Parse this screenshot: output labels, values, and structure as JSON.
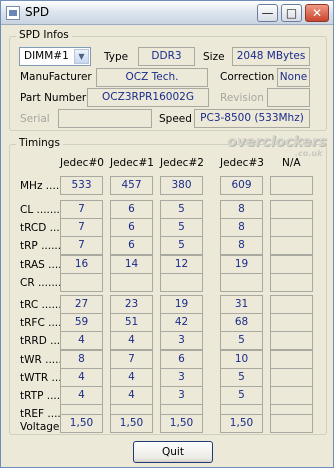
{
  "window": {
    "title": "SPD"
  },
  "spd_infos": {
    "group_title": "SPD Infos",
    "dimm_selected": "DIMM#1",
    "type_label": "Type",
    "type_value": "DDR3",
    "size_label": "Size",
    "size_value": "2048 MBytes",
    "manufacturer_label": "ManuFacturer",
    "manufacturer_value": "OCZ Tech.",
    "correction_label": "Correction",
    "correction_value": "None",
    "part_label": "Part Number",
    "part_value": "OCZ3RPR16002G",
    "revision_label": "Revision",
    "revision_value": "",
    "serial_label": "Serial",
    "serial_value": "",
    "speed_label": "Speed",
    "speed_value": "PC3-8500 (533Mhz)"
  },
  "timings": {
    "group_title": "Timings",
    "columns": [
      "Jedec#0",
      "Jedec#1",
      "Jedec#2",
      "Jedec#3",
      "N/A"
    ],
    "rows": [
      {
        "label": "MHz ........",
        "values": [
          "533",
          "457",
          "380",
          "609",
          ""
        ]
      },
      {
        "label": "CL ........",
        "values": [
          "7",
          "6",
          "5",
          "8",
          ""
        ]
      },
      {
        "label": "tRCD .....",
        "values": [
          "7",
          "6",
          "5",
          "8",
          ""
        ]
      },
      {
        "label": "tRP .......",
        "values": [
          "7",
          "6",
          "5",
          "8",
          ""
        ]
      },
      {
        "label": "tRAS .....",
        "values": [
          "16",
          "14",
          "12",
          "19",
          ""
        ]
      },
      {
        "label": "CR ........",
        "values": [
          "",
          "",
          "",
          "",
          ""
        ]
      },
      {
        "label": "tRC .......",
        "values": [
          "27",
          "23",
          "19",
          "31",
          ""
        ]
      },
      {
        "label": "tRFC .....",
        "values": [
          "59",
          "51",
          "42",
          "68",
          ""
        ]
      },
      {
        "label": "tRRD .....",
        "values": [
          "4",
          "4",
          "3",
          "5",
          ""
        ]
      },
      {
        "label": "tWR ......",
        "values": [
          "8",
          "7",
          "6",
          "10",
          ""
        ]
      },
      {
        "label": "tWTR ....",
        "values": [
          "4",
          "4",
          "3",
          "5",
          ""
        ]
      },
      {
        "label": "tRTP .....",
        "values": [
          "4",
          "4",
          "3",
          "5",
          ""
        ]
      },
      {
        "label": "tREF .....",
        "values": [
          "",
          "",
          "",
          "",
          ""
        ]
      },
      {
        "label": "Voltage",
        "values": [
          "1,50",
          "1,50",
          "1,50",
          "1,50",
          ""
        ]
      }
    ]
  },
  "watermark": {
    "main": "overclockers",
    "sub": ".co.uk"
  },
  "footer": {
    "quit_label": "Quit"
  },
  "colors": {
    "value_text": "#1a2b8c",
    "window_bg": "#ece9d8",
    "close_button": "#c9442c"
  }
}
